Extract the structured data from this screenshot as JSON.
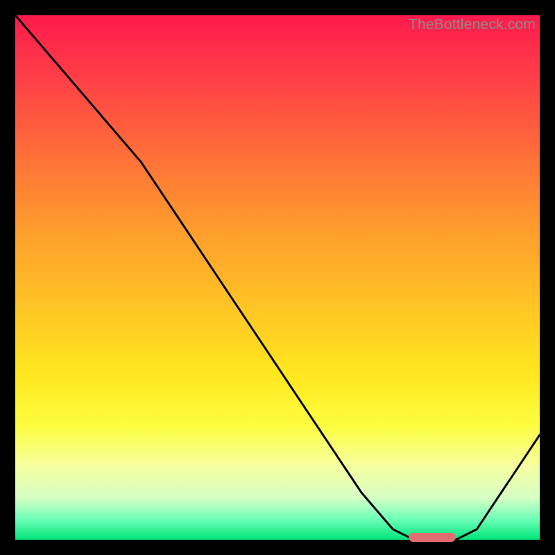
{
  "watermark": "TheBottleneck.com",
  "colors": {
    "bg": "#000000",
    "gradient_top": "#ff1a4d",
    "gradient_bottom": "#00e57a",
    "curve": "#000000",
    "pill": "#e26f6f",
    "watermark": "#8c8c8c"
  },
  "chart_data": {
    "type": "line",
    "title": "",
    "xlabel": "",
    "ylabel": "",
    "xlim": [
      0,
      100
    ],
    "ylim": [
      0,
      100
    ],
    "x": [
      0,
      6,
      12,
      18,
      24,
      30,
      36,
      42,
      48,
      54,
      60,
      66,
      72,
      76,
      80,
      84,
      88,
      92,
      96,
      100
    ],
    "values": [
      100,
      93,
      86,
      79,
      72,
      63,
      54,
      45,
      36,
      27,
      18,
      9,
      2,
      0,
      0,
      0,
      2,
      8,
      14,
      20
    ],
    "minimum_marker": {
      "x_start": 75,
      "x_end": 84,
      "y": 0
    }
  }
}
